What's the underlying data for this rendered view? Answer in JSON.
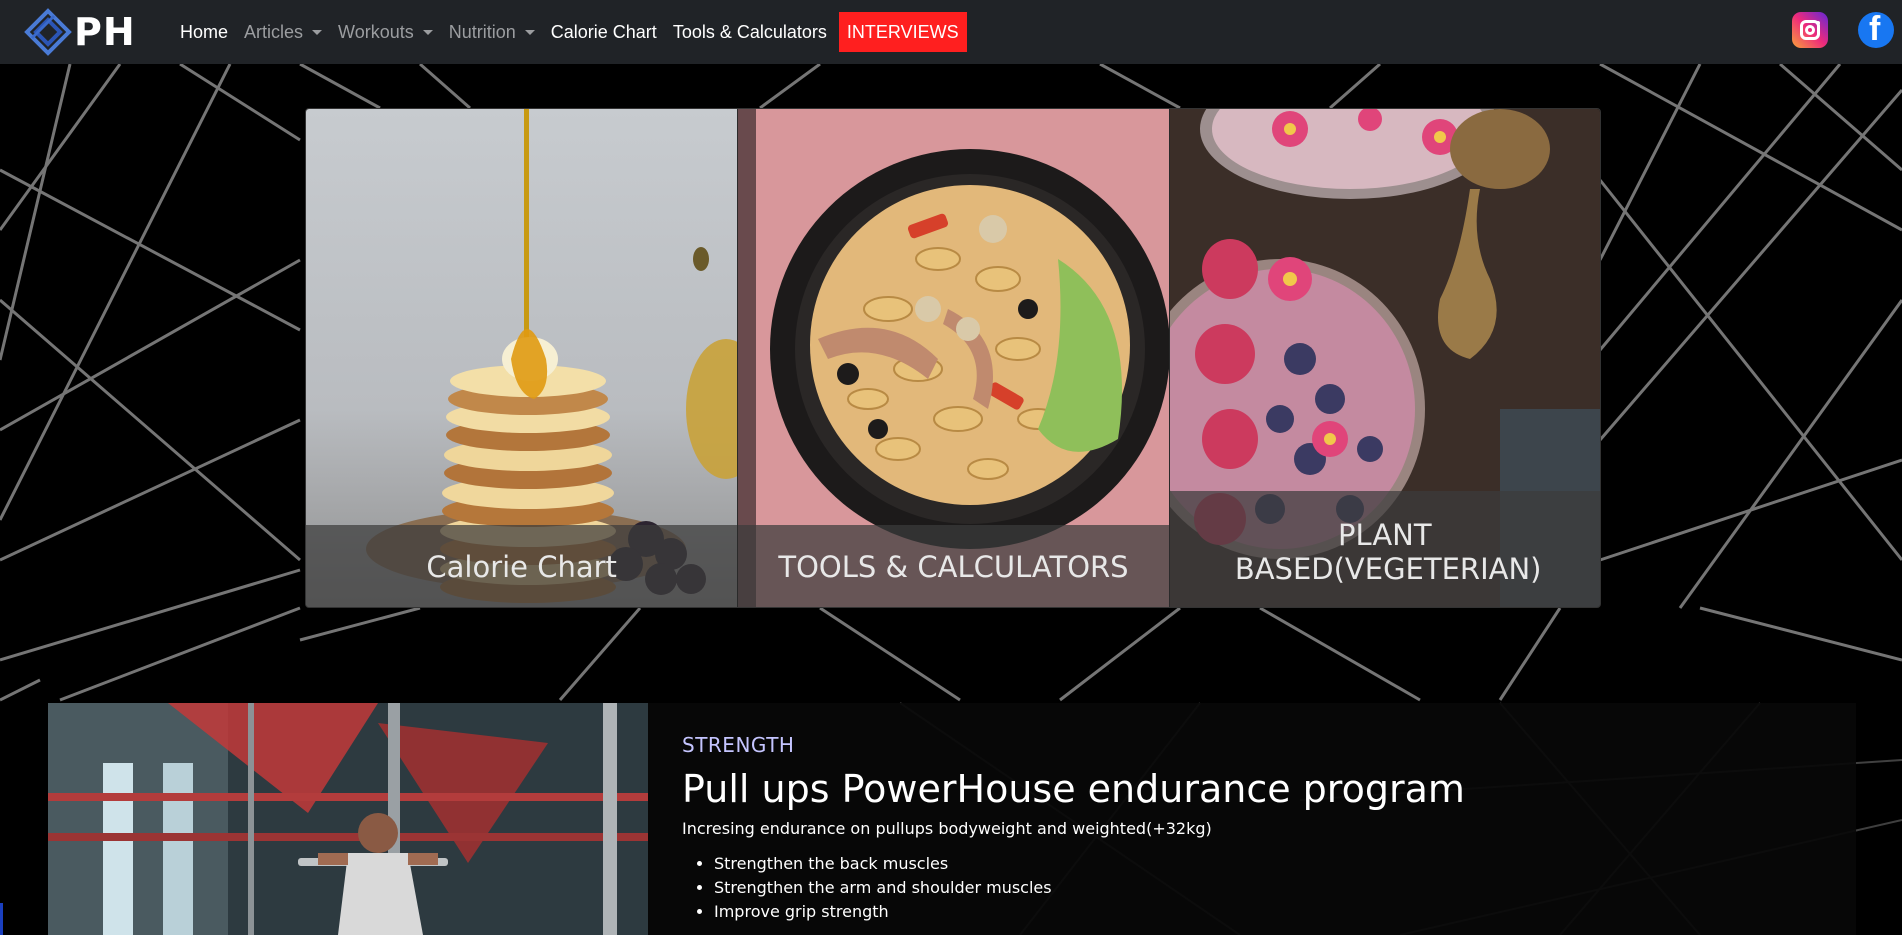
{
  "brand": {
    "logo_text": "PH"
  },
  "nav": {
    "home": "Home",
    "articles": "Articles",
    "workouts": "Workouts",
    "nutrition": "Nutrition",
    "calorie_chart": "Calorie Chart",
    "tools": "Tools & Calculators",
    "interviews": "INTERVIEWS"
  },
  "social": {
    "instagram_icon": "instagram-icon",
    "facebook_icon": "facebook-icon"
  },
  "colors": {
    "navbar_bg": "#202327",
    "interviews_bg": "#ff1f1f",
    "kicker": "#c5c5ff",
    "facebook": "#1877f2"
  },
  "cards": [
    {
      "title": "Calorie Chart"
    },
    {
      "title": "TOOLS & CALCULATORS"
    },
    {
      "title": "PLANT BASED(VEGETERIAN)"
    }
  ],
  "article": {
    "category": "STRENGTH",
    "title": "Pull ups PowerHouse endurance program",
    "subtitle": "Incresing endurance on pullups bodyweight and weighted(+32kg)",
    "bullets": [
      "Strengthen the back muscles",
      "Strengthen the arm and shoulder muscles",
      "Improve grip strength"
    ]
  }
}
